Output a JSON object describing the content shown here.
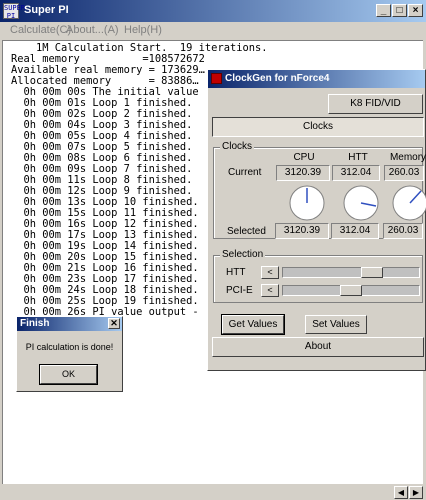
{
  "superpi": {
    "title": "Super PI",
    "icon_text": "SUPER PI",
    "menu": [
      "Calculate(C)",
      "About...(A)",
      "Help(H)"
    ],
    "lines": [
      "    1M Calculation Start.  19 iterations.",
      "Real memory          =108572672",
      "Available real memory = 173629…",
      "Allocated memory      = 83886…",
      "  0h 00m 00s The initial value",
      "  0h 00m 01s Loop 1 finished.",
      "  0h 00m 02s Loop 2 finished.",
      "  0h 00m 04s Loop 3 finished.",
      "  0h 00m 05s Loop 4 finished.",
      "  0h 00m 07s Loop 5 finished.",
      "  0h 00m 08s Loop 6 finished.",
      "  0h 00m 09s Loop 7 finished.",
      "  0h 00m 11s Loop 8 finished.",
      "  0h 00m 12s Loop 9 finished.",
      "  0h 00m 13s Loop 10 finished.",
      "  0h 00m 15s Loop 11 finished.",
      "  0h 00m 16s Loop 12 finished.",
      "  0h 00m 17s Loop 13 finished.",
      "  0h 00m 19s Loop 14 finished.",
      "  0h 00m 20s Loop 15 finished.",
      "  0h 00m 21s Loop 16 finished.",
      "  0h 00m 23s Loop 17 finished.",
      "  0h 00m 24s Loop 18 finished.",
      "  0h 00m 25s Loop 19 finished.",
      "  0h 00m 26s PI value output -"
    ]
  },
  "finish": {
    "title": "Finish",
    "message": "PI calculation is done!",
    "ok_label": "OK",
    "close_glyph": "✕"
  },
  "clockgen": {
    "title": "ClockGen for nForce4",
    "tab_k8": "K8 FID/VID",
    "tab_clocks": "Clocks",
    "clocks_group": "Clocks",
    "col_cpu": "CPU",
    "col_htt": "HTT",
    "col_memory": "Memory",
    "row_current": "Current",
    "row_selected": "Selected",
    "current": {
      "cpu": "3120.39",
      "htt": "312.04",
      "memory": "260.03"
    },
    "selected": {
      "cpu": "3120.39",
      "htt": "312.04",
      "memory": "260.03"
    },
    "selection_group": "Selection",
    "htt_label": "HTT",
    "pcie_label": "PCI-E",
    "htt_slider_level": 0.68,
    "pcie_slider_level": 0.5,
    "get_values": "Get Values",
    "set_values": "Set Values",
    "about": "About"
  }
}
